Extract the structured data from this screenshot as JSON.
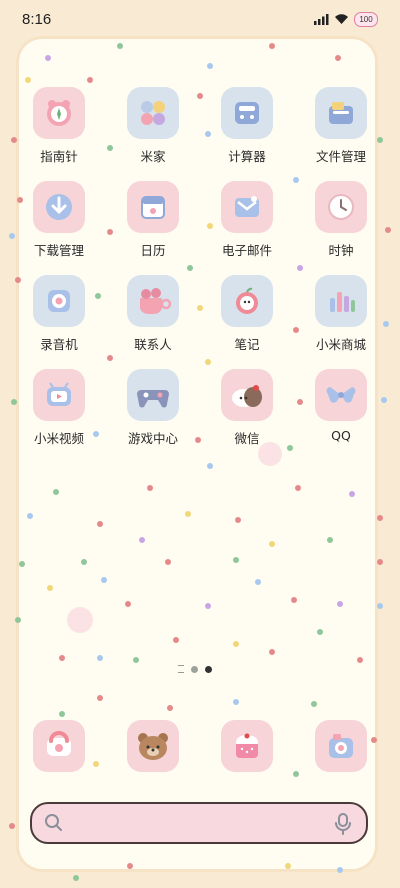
{
  "status": {
    "time": "8:16",
    "battery": "100"
  },
  "apps": [
    {
      "label": "指南针",
      "icon": "compass-icon"
    },
    {
      "label": "米家",
      "icon": "mijia-icon"
    },
    {
      "label": "计算器",
      "icon": "calculator-icon"
    },
    {
      "label": "文件管理",
      "icon": "file-manager-icon"
    },
    {
      "label": "下载管理",
      "icon": "download-icon"
    },
    {
      "label": "日历",
      "icon": "calendar-icon"
    },
    {
      "label": "电子邮件",
      "icon": "email-icon"
    },
    {
      "label": "时钟",
      "icon": "clock-icon"
    },
    {
      "label": "录音机",
      "icon": "recorder-icon"
    },
    {
      "label": "联系人",
      "icon": "contacts-icon"
    },
    {
      "label": "笔记",
      "icon": "notes-icon"
    },
    {
      "label": "小米商城",
      "icon": "mi-store-icon"
    },
    {
      "label": "小米视频",
      "icon": "mi-video-icon"
    },
    {
      "label": "游戏中心",
      "icon": "game-center-icon"
    },
    {
      "label": "微信",
      "icon": "wechat-icon"
    },
    {
      "label": "QQ",
      "icon": "qq-icon"
    }
  ],
  "dock": [
    {
      "icon": "phone-icon"
    },
    {
      "icon": "messages-bear-icon"
    },
    {
      "icon": "browser-cake-icon"
    },
    {
      "icon": "camera-icon"
    }
  ],
  "pager": {
    "pages": 2,
    "active": 2
  },
  "colors": {
    "wallpaper": "#f9ead3",
    "card": "#fffdf2",
    "tile_pink": "#f6d4d8",
    "tile_blue": "#d7e2ec",
    "search": "#f8d9df"
  }
}
